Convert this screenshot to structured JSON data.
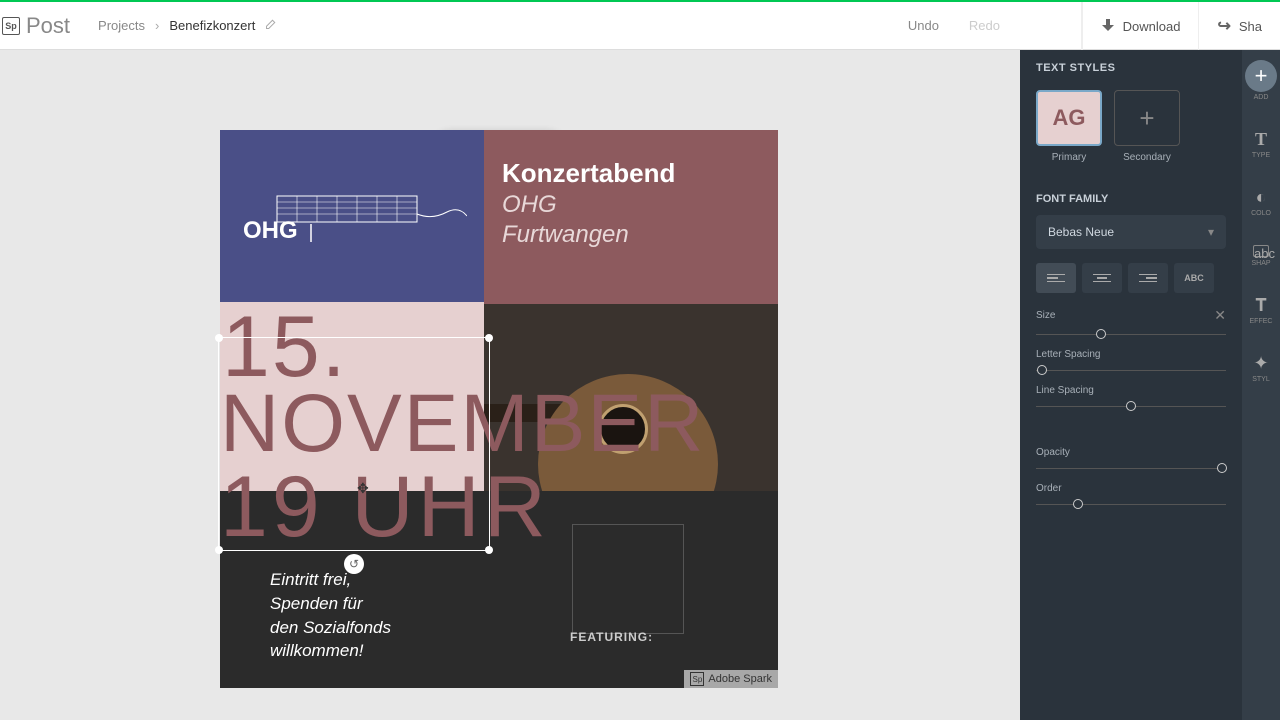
{
  "header": {
    "logo_sp": "Sp",
    "logo_text": "Post",
    "breadcrumb_root": "Projects",
    "breadcrumb_current": "Benefizkonzert",
    "undo": "Undo",
    "redo": "Redo",
    "download": "Download",
    "share": "Sha"
  },
  "poster": {
    "ohg_label": "OHG",
    "title": "Konzertabend",
    "subtitle1": "OHG",
    "subtitle2": "Furtwangen",
    "date_day": "15.",
    "date_month": "NOVEMBER",
    "date_time": "19 UHR",
    "footer_l1": "Eintritt frei,",
    "footer_l2": "Spenden für",
    "footer_l3": "den Sozialfonds",
    "footer_l4": "willkommen!",
    "featuring": "FEATURING:",
    "watermark": "Adobe Spark",
    "watermark_sp": "Sp"
  },
  "panel": {
    "text_styles": "TEXT STYLES",
    "primary_sample": "AG",
    "primary_caption": "Primary",
    "secondary_caption": "Secondary",
    "font_family": "FONT FAMILY",
    "font_value": "Bebas Neue",
    "size": "Size",
    "letter_spacing": "Letter Spacing",
    "line_spacing": "Line Spacing",
    "opacity": "Opacity",
    "order": "Order",
    "sliders": {
      "size_pct": 34,
      "letter_pct": 3,
      "line_pct": 50,
      "opacity_pct": 98,
      "order_pct": 22
    }
  },
  "far": {
    "add": "ADD",
    "type": "TYPE",
    "color": "COLO",
    "shape": "SHAP",
    "effect": "EFFEC",
    "style": "STYL"
  }
}
